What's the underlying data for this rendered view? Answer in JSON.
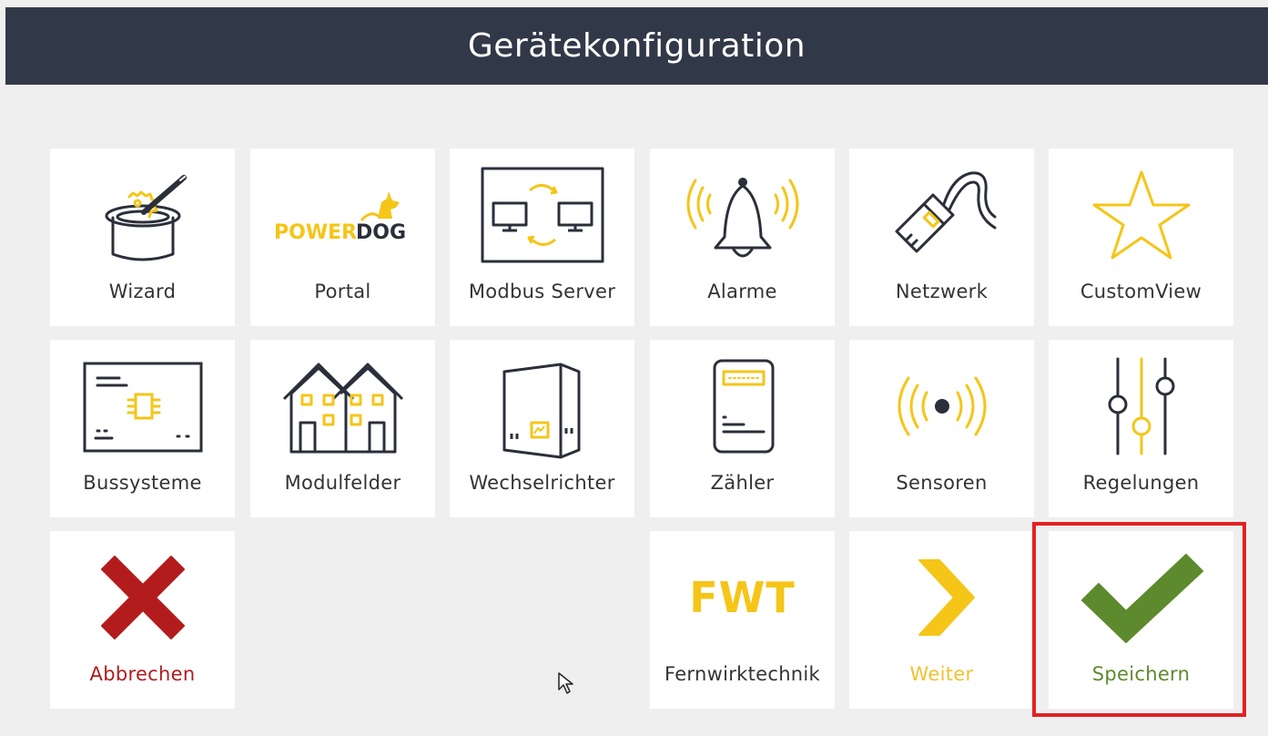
{
  "header": {
    "title": "Gerätekonfiguration"
  },
  "tiles": {
    "wizard": "Wizard",
    "portal": "Portal",
    "modbus_server": "Modbus Server",
    "alarme": "Alarme",
    "netzwerk": "Netzwerk",
    "customview": "CustomView",
    "bussysteme": "Bussysteme",
    "modulfelder": "Modulfelder",
    "wechselrichter": "Wechselrichter",
    "zaehler": "Zähler",
    "sensoren": "Sensoren",
    "regelungen": "Regelungen",
    "abbrechen": "Abbrechen",
    "fernwirktechnik": "Fernwirktechnik",
    "weiter": "Weiter",
    "speichern": "Speichern"
  },
  "logos": {
    "powerdog_power": "POWER",
    "powerdog_dog": "DOG",
    "fwt": "FWT"
  },
  "colors": {
    "accent": "#f5c518",
    "dark": "#2b2f3a",
    "header": "#313848",
    "cancel": "#b31c1c",
    "save": "#5d8a2c",
    "highlight": "#e32222"
  },
  "icons": {
    "wizard": "magic-hat-icon",
    "portal": "powerdog-logo",
    "modbus_server": "modbus-server-icon",
    "alarme": "alarm-bell-icon",
    "netzwerk": "network-cable-icon",
    "customview": "star-icon",
    "bussysteme": "bus-board-icon",
    "modulfelder": "houses-icon",
    "wechselrichter": "inverter-icon",
    "zaehler": "meter-icon",
    "sensoren": "sensor-waves-icon",
    "regelungen": "sliders-icon",
    "abbrechen": "close-icon",
    "fernwirktechnik": "fwt-logo",
    "weiter": "chevron-right-icon",
    "speichern": "checkmark-icon"
  }
}
